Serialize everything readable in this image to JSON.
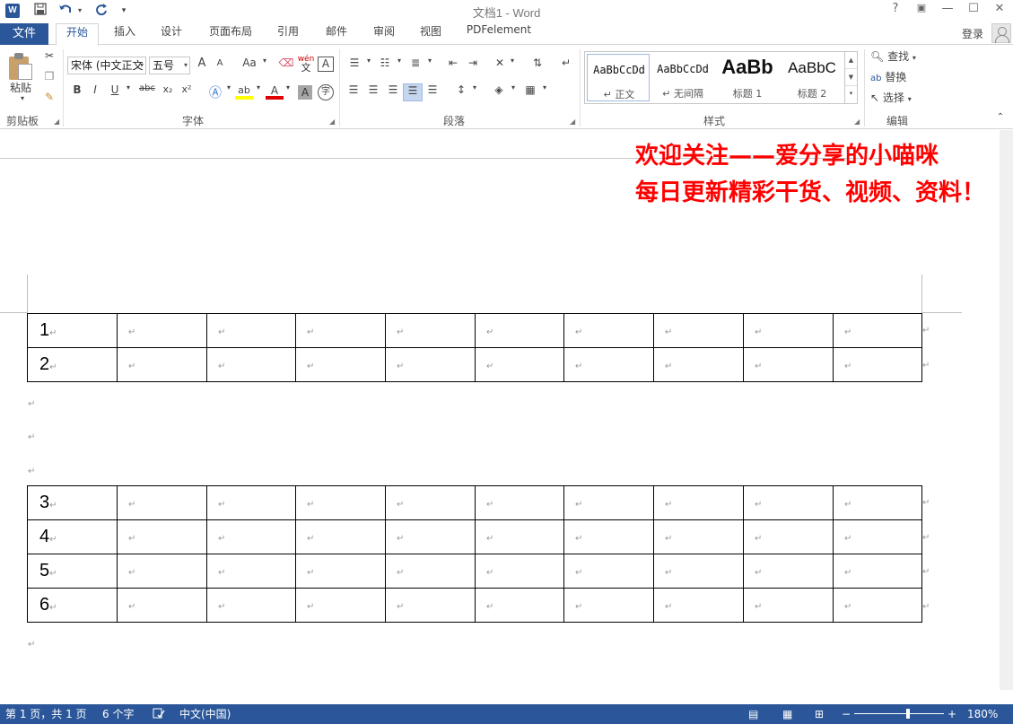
{
  "window": {
    "title": "文档1 - Word",
    "help": "?",
    "controls": {
      "ribbon_display": "▣",
      "minimize": "—",
      "maximize": "☐",
      "close": "✕"
    }
  },
  "qat": {
    "save_icon": "save-icon",
    "undo_icon": "undo-icon",
    "redo_icon": "redo-icon",
    "customize": "▾"
  },
  "tabs": {
    "file": "文件",
    "items": [
      "开始",
      "插入",
      "设计",
      "页面布局",
      "引用",
      "邮件",
      "审阅",
      "视图",
      "PDFelement"
    ],
    "active": "开始",
    "login": "登录"
  },
  "ribbon": {
    "clipboard": {
      "label": "剪贴板",
      "paste": "粘贴"
    },
    "font": {
      "label": "字体",
      "font_name": "宋体 (中文正文",
      "font_size": "五号",
      "grow": "A",
      "shrink": "A",
      "case": "Aa",
      "bold": "B",
      "italic": "I",
      "underline": "U",
      "strike": "abc",
      "subscript": "x₂",
      "superscript": "x²",
      "font_color": "A",
      "shading": "A",
      "enclose": "字",
      "phonetic": "wén",
      "border_char": "A"
    },
    "paragraph": {
      "label": "段落"
    },
    "styles": {
      "label": "样式",
      "items": [
        {
          "sample": "AaBbCcDd",
          "name": "↵ 正文"
        },
        {
          "sample": "AaBbCcDd",
          "name": "↵ 无间隔"
        },
        {
          "sample": "AaBb",
          "name": "标题 1"
        },
        {
          "sample": "AaBbC",
          "name": "标题 2"
        }
      ]
    },
    "editing": {
      "label": "编辑",
      "find": "查找",
      "replace": "替换",
      "select": "选择"
    }
  },
  "document": {
    "banner_line1": "欢迎关注——爱分享的小喵咪",
    "banner_line2": "每日更新精彩干货、视频、资料！",
    "mark": "↵",
    "table1": {
      "rows": [
        "1",
        "2"
      ],
      "columns": 10
    },
    "table2": {
      "rows": [
        "3",
        "4",
        "5",
        "6"
      ],
      "columns": 10
    }
  },
  "status": {
    "page": "第 1 页，共 1 页",
    "words": "6 个字",
    "proof_icon": "proofing-icon",
    "language": "中文(中国)",
    "zoom_out": "−",
    "zoom_in": "+",
    "zoom": "180%",
    "zoom_level": 0.58
  }
}
